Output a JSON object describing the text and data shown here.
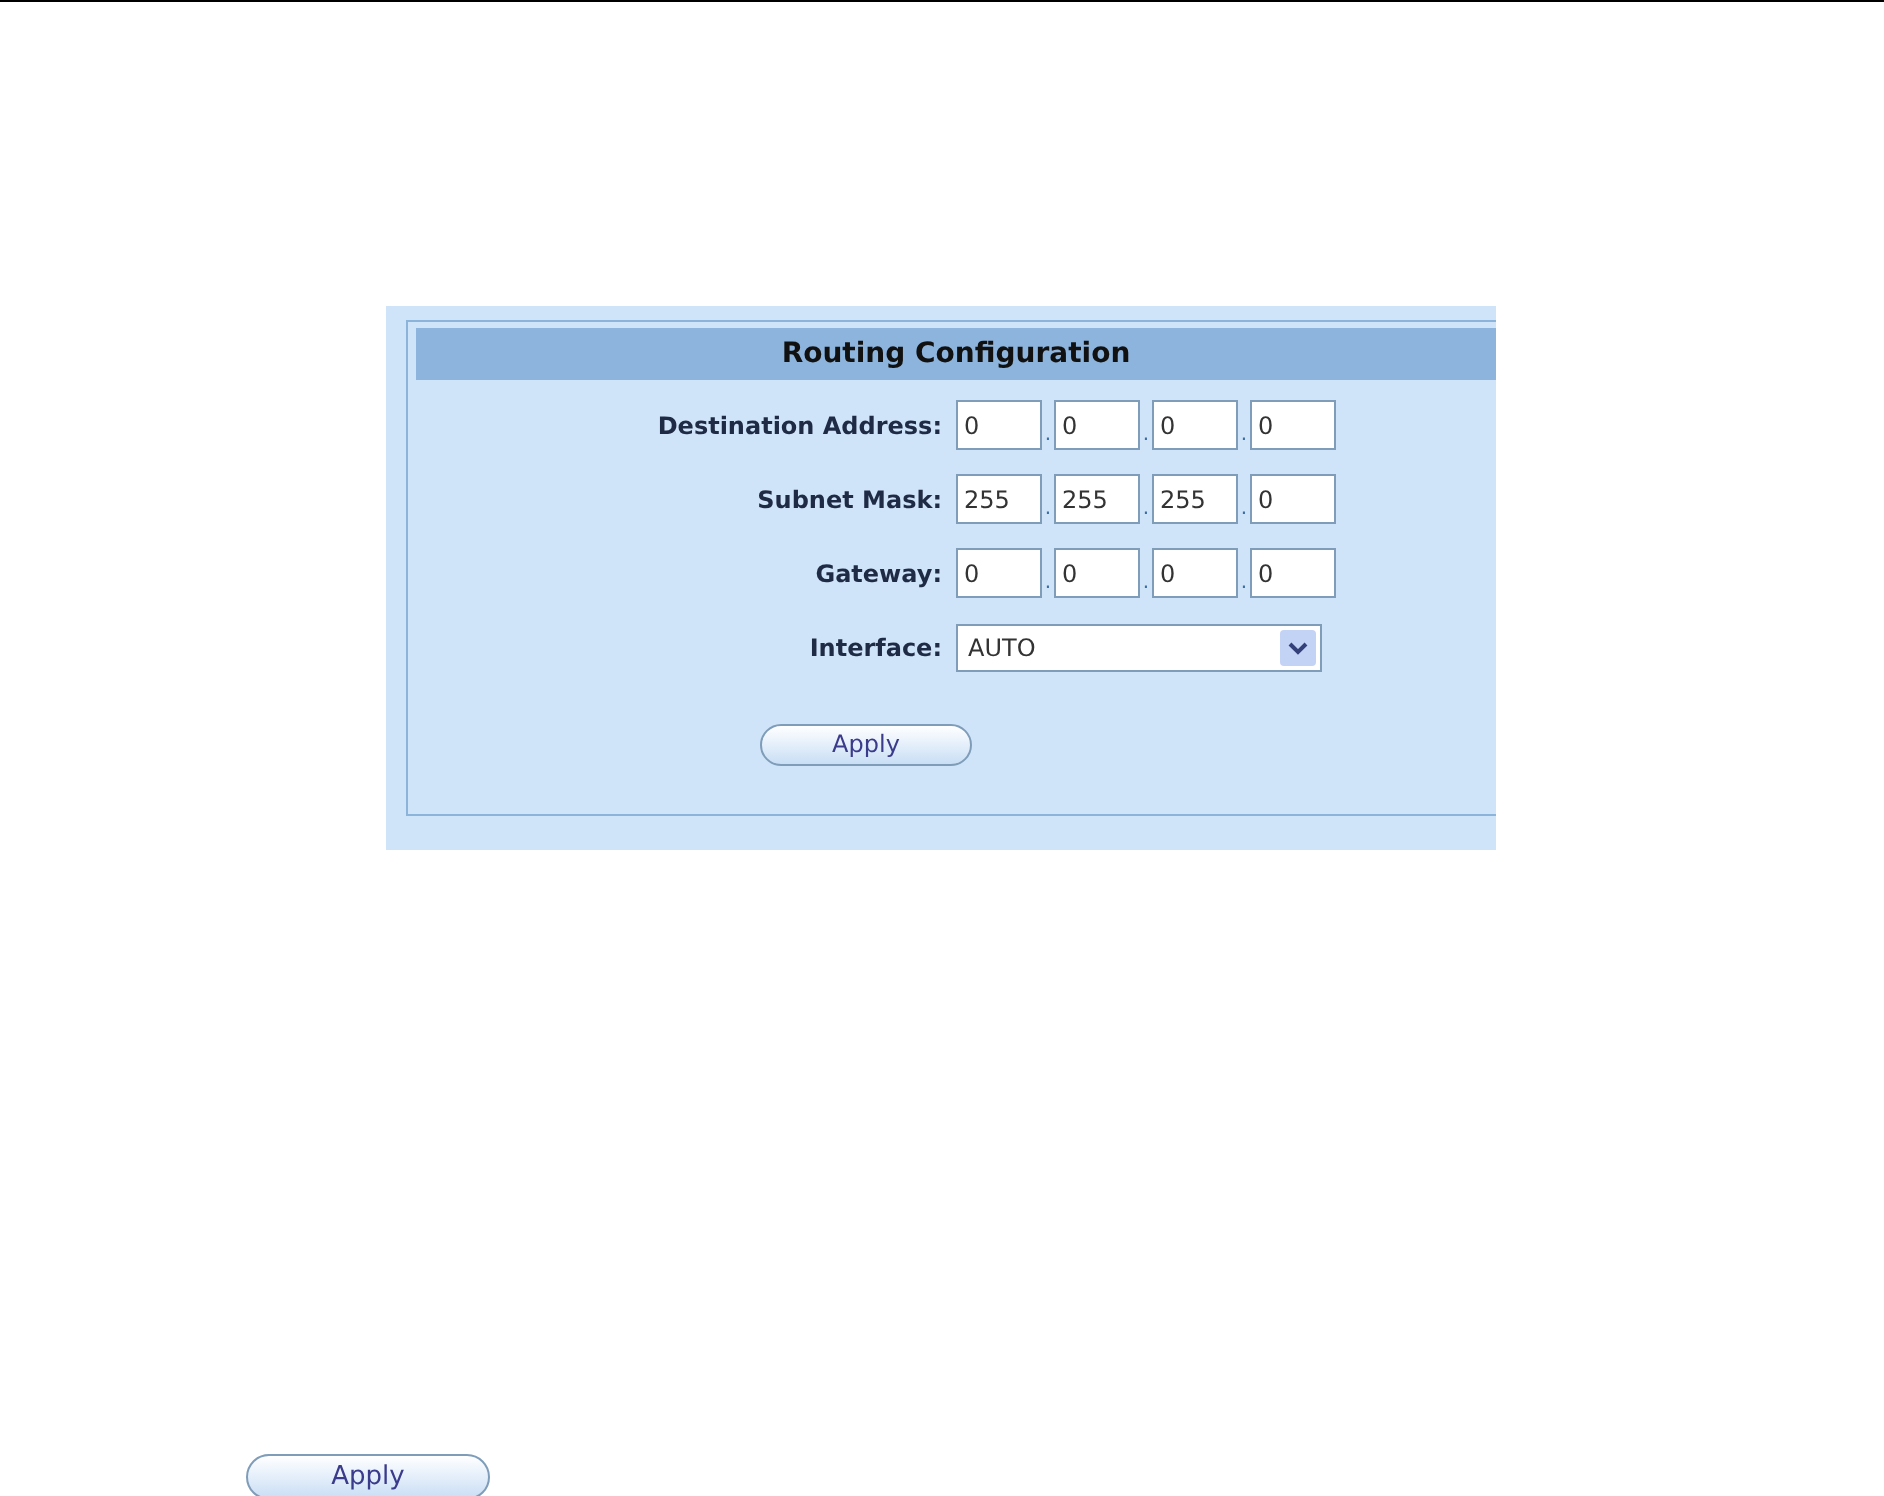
{
  "panel": {
    "title": "Routing Configuration",
    "fields": [
      {
        "kind": "ip",
        "label": "Destination Address:",
        "octets": [
          "0",
          "0",
          "0",
          "0"
        ],
        "separators": [
          ".",
          ".",
          "."
        ]
      },
      {
        "kind": "ip",
        "label": "Subnet Mask:",
        "octets": [
          "255",
          "255",
          "255",
          "0"
        ],
        "separators": [
          ".",
          ".",
          "."
        ]
      },
      {
        "kind": "ip",
        "label": "Gateway:",
        "octets": [
          "0",
          "0",
          "0",
          "0"
        ],
        "separators": [
          ".",
          ".",
          "."
        ]
      },
      {
        "kind": "select",
        "label": "Interface:",
        "value": "AUTO"
      }
    ],
    "button": "Apply"
  },
  "standalone_button": "Apply"
}
